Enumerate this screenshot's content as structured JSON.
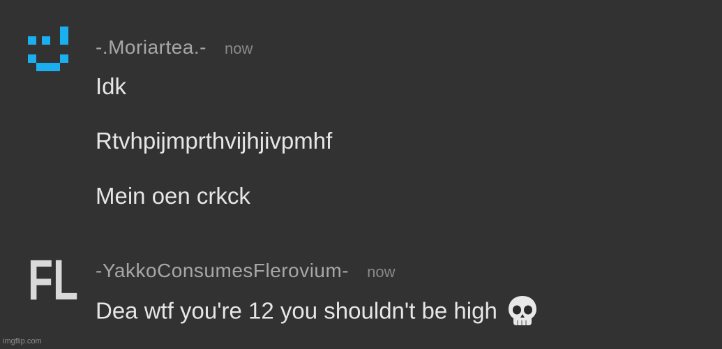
{
  "messages": [
    {
      "username": "-.Moriartea.-",
      "timestamp": "now",
      "lines": [
        "Idk",
        "Rtvhpijmprthvijhjivpmhf",
        "Mein oen crkck"
      ]
    },
    {
      "username": "-YakkoConsumesFlerovium-",
      "timestamp": "now",
      "avatar_text": "FL",
      "lines": [
        "Dea wtf you're 12 you shouldn't be high"
      ],
      "emoji": "skull-icon"
    }
  ],
  "watermark": "imgflip.com",
  "colors": {
    "background": "#323233",
    "username": "#a7a7a7",
    "timestamp": "#8a8a8a",
    "message_text": "#e6e6e6",
    "avatar_accent": "#1ab0ef",
    "avatar_fl": "#d9d9d9"
  }
}
